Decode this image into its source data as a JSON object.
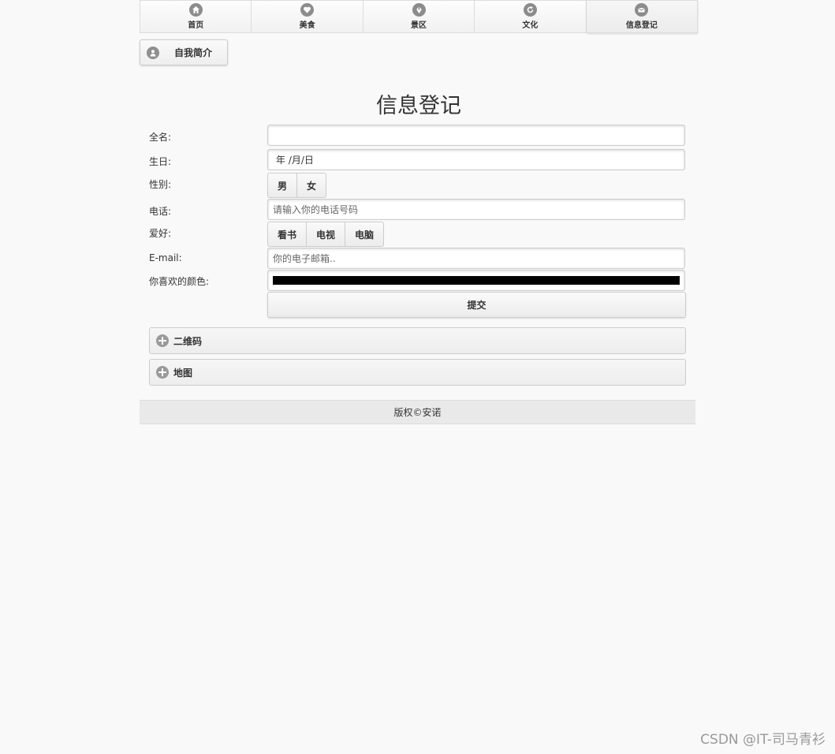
{
  "nav": {
    "items": [
      {
        "label": "首页",
        "icon": "home-icon"
      },
      {
        "label": "美食",
        "icon": "heart-icon"
      },
      {
        "label": "景区",
        "icon": "location-icon"
      },
      {
        "label": "文化",
        "icon": "refresh-icon"
      },
      {
        "label": "信息登记",
        "icon": "mail-icon",
        "active": true
      }
    ]
  },
  "profile_button": {
    "label": "自我简介",
    "icon": "user-icon"
  },
  "page_title": "信息登记",
  "form": {
    "name_label": "全名:",
    "name_value": "",
    "birthday_label": "生日:",
    "birthday_value": "年 /月/日",
    "gender_label": "性别:",
    "gender_options": [
      "男",
      "女"
    ],
    "phone_label": "电话:",
    "phone_placeholder": "请输入你的电话号码",
    "hobby_label": "爱好:",
    "hobby_options": [
      "看书",
      "电视",
      "电脑"
    ],
    "email_label": "E-mail:",
    "email_placeholder": "你的电子邮箱..",
    "color_label": "你喜欢的颜色:",
    "color_value": "#000000",
    "submit_label": "提交"
  },
  "collapsibles": [
    {
      "title": "二维码",
      "icon": "plus-icon"
    },
    {
      "title": "地图",
      "icon": "plus-icon"
    }
  ],
  "footer": "版权©安诺",
  "watermark": "CSDN @IT-司马青衫"
}
